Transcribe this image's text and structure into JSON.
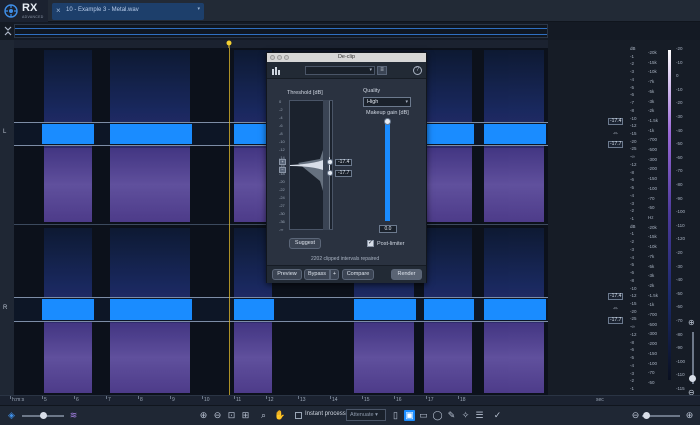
{
  "app": {
    "name": "RX",
    "edition": "ADVANCED"
  },
  "tab": {
    "close_glyph": "×",
    "title": "10 - Example 3 - Metal.wav",
    "dropdown_glyph": "▾"
  },
  "channels": {
    "left": "L",
    "right": "R"
  },
  "dialog": {
    "title": "De-clip",
    "threshold_label": "Threshold [dB]",
    "threshold_scale": [
      "0",
      "-2",
      "-4",
      "-6",
      "-8",
      "-10",
      "-12",
      "-14",
      "-16",
      "-18",
      "-20",
      "-22",
      "-24",
      "-27",
      "-30",
      "-36",
      "-∞"
    ],
    "threshold_upper": "-17.4",
    "threshold_lower": "-17.7",
    "quality_label": "Quality",
    "quality_value": "High",
    "makeup_label": "Makeup gain [dB]",
    "makeup_value": "0.0",
    "makeup_level": 1.0,
    "suggest_label": "Suggest",
    "post_limiter_label": "Post-limiter",
    "post_limiter_checked": true,
    "status": "2202 clipped intervals repaired",
    "preview_label": "Preview",
    "bypass_label": "Bypass",
    "bypass_plus": "+",
    "compare_label": "Compare",
    "render_label": "Render",
    "help_glyph": "?",
    "menu_glyph": "≡"
  },
  "scales": {
    "db_left": [
      "dB",
      "-1",
      "-2",
      "-3",
      "-4",
      "-5",
      "-6",
      "-7",
      "-8",
      "-10",
      "-12",
      "-15",
      "-20",
      "-25",
      "-∞",
      "-12",
      "-8",
      "-6",
      "-5",
      "-4",
      "-3",
      "-2",
      "-1",
      "dB",
      "-1",
      "-2",
      "-3",
      "-4",
      "-5",
      "-6",
      "-8",
      "-10",
      "-12",
      "-15",
      "-20",
      "-25",
      "-∞",
      "-12",
      "-8",
      "-6",
      "-5",
      "-4",
      "-3",
      "-2",
      "-1"
    ],
    "hz": [
      "-20k",
      "-15k",
      "-10k",
      "-7k",
      "-5k",
      "-3k",
      "-2k",
      "-1.5k",
      "-1k",
      "-700",
      "-500",
      "-300",
      "-200",
      "-150",
      "-100",
      "-70",
      "-50",
      "Hz",
      "-20k",
      "-15k",
      "-10k",
      "-7k",
      "-5k",
      "-3k",
      "-2k",
      "-1.5k",
      "-1k",
      "-700",
      "-500",
      "-300",
      "-200",
      "-150",
      "-100",
      "-70",
      "-50"
    ],
    "db_right": [
      "-20",
      "-10",
      "0",
      "-10",
      "-20",
      "-30",
      "-40",
      "-50",
      "-60",
      "-70",
      "-80",
      "-90",
      "-100",
      "-110",
      "-120",
      "-20",
      "-30",
      "-40",
      "-50",
      "-60",
      "-70",
      "-80",
      "-90",
      "-100",
      "-110",
      "-115"
    ],
    "tags_l": [
      "-17.4",
      "-17.7"
    ],
    "tags_r": [
      "-17.4",
      "-17.7"
    ]
  },
  "time_ruler": {
    "labels": [
      "h:m:s",
      "5",
      "6",
      "7",
      "8",
      "9",
      "10",
      "11",
      "12",
      "13",
      "14",
      "15",
      "16",
      "17",
      "18"
    ],
    "unit": "sec"
  },
  "toolbar": {
    "instant_process": "Instant process",
    "attenuate": "Attenuate"
  }
}
